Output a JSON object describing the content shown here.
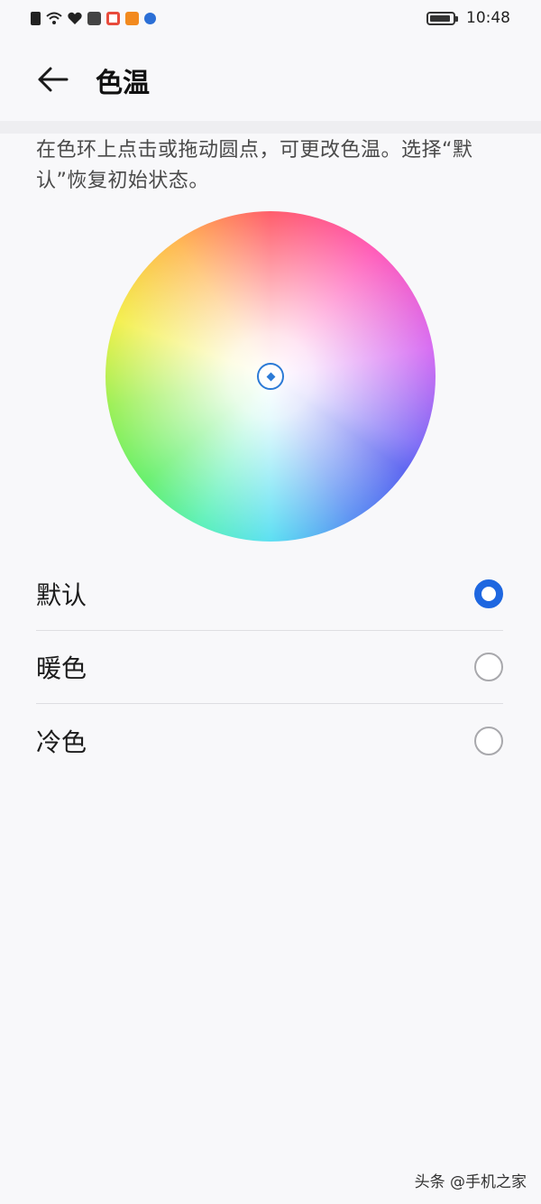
{
  "status_bar": {
    "time": "10:48",
    "icons": [
      "sim-icon",
      "wifi-icon",
      "heart-icon",
      "mail-icon",
      "app-red-icon",
      "app-orange-icon",
      "app-blue-icon"
    ]
  },
  "header": {
    "title": "色温"
  },
  "description": "在色环上点击或拖动圆点，可更改色温。选择“默认”恢复初始状态。",
  "options": [
    {
      "label": "默认",
      "selected": true
    },
    {
      "label": "暖色",
      "selected": false
    },
    {
      "label": "冷色",
      "selected": false
    }
  ],
  "watermark": "头条 @手机之家",
  "colors": {
    "accent": "#1e67e0",
    "picker": "#2c7ad6"
  }
}
